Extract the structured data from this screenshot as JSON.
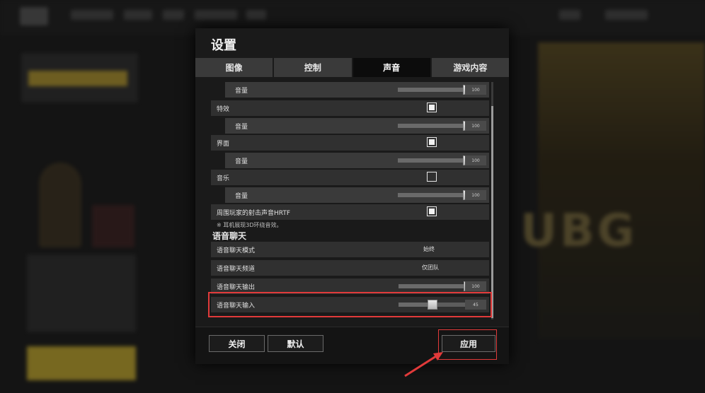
{
  "dialog": {
    "title": "设置",
    "tabs": [
      {
        "label": "图像",
        "active": false
      },
      {
        "label": "控制",
        "active": false
      },
      {
        "label": "声音",
        "active": true
      },
      {
        "label": "游戏内容",
        "active": false
      }
    ],
    "rows": {
      "volume_top": {
        "label": "音量",
        "value": "100",
        "level": 1.0
      },
      "effects": {
        "label": "特效",
        "checked": true
      },
      "effects_volume": {
        "label": "音量",
        "value": "100",
        "level": 1.0
      },
      "ui": {
        "label": "界面",
        "checked": true
      },
      "ui_volume": {
        "label": "音量",
        "value": "100",
        "level": 1.0
      },
      "music": {
        "label": "音乐",
        "checked": false
      },
      "music_volume": {
        "label": "音量",
        "value": "100",
        "level": 1.0
      },
      "hrtf": {
        "label": "周围玩家的射击声音HRTF",
        "checked": true
      },
      "hrtf_note": "※ 耳机展现3D环绕音效。"
    },
    "voice_chat": {
      "heading": "语音聊天",
      "mode": {
        "label": "语音聊天模式",
        "value": "始终"
      },
      "channel": {
        "label": "语音聊天频道",
        "value": "仅团队"
      },
      "output": {
        "label": "语音聊天输出",
        "value": "100",
        "level": 1.0
      },
      "input": {
        "label": "语音聊天输入",
        "value": "45",
        "level": 0.45
      }
    },
    "buttons": {
      "close": "关闭",
      "default": "默认",
      "apply": "应用"
    }
  },
  "colors": {
    "highlight": "#e13a3a",
    "active_tab": "#0c0c0c",
    "row": "#303030"
  }
}
